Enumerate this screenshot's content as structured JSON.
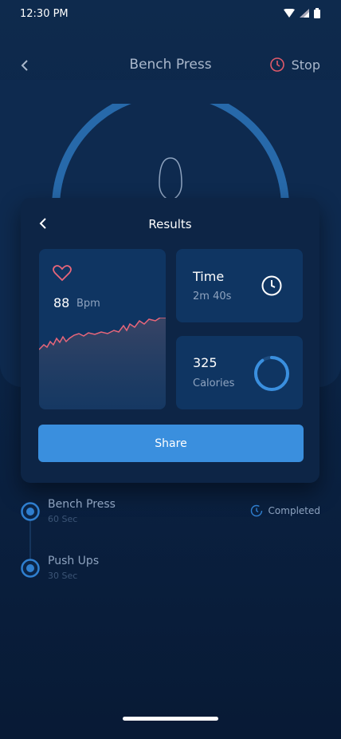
{
  "status_bar": {
    "time": "12:30 PM"
  },
  "header": {
    "title": "Bench Press",
    "stop_label": "Stop"
  },
  "results": {
    "title": "Results",
    "heart_rate": {
      "value": "88",
      "unit": "Bpm"
    },
    "time": {
      "label": "Time",
      "value": "2m 40s"
    },
    "calories": {
      "value": "325",
      "label": "Calories",
      "ring_fraction": 0.9
    },
    "share_label": "Share"
  },
  "timeline": [
    {
      "name": "Bench Press",
      "duration": "60 Sec",
      "status": "Completed"
    },
    {
      "name": "Push Ups",
      "duration": "30 Sec"
    }
  ],
  "colors": {
    "accent": "#3a8fde",
    "heart": "#e8667a",
    "stop": "#e05a6a"
  }
}
